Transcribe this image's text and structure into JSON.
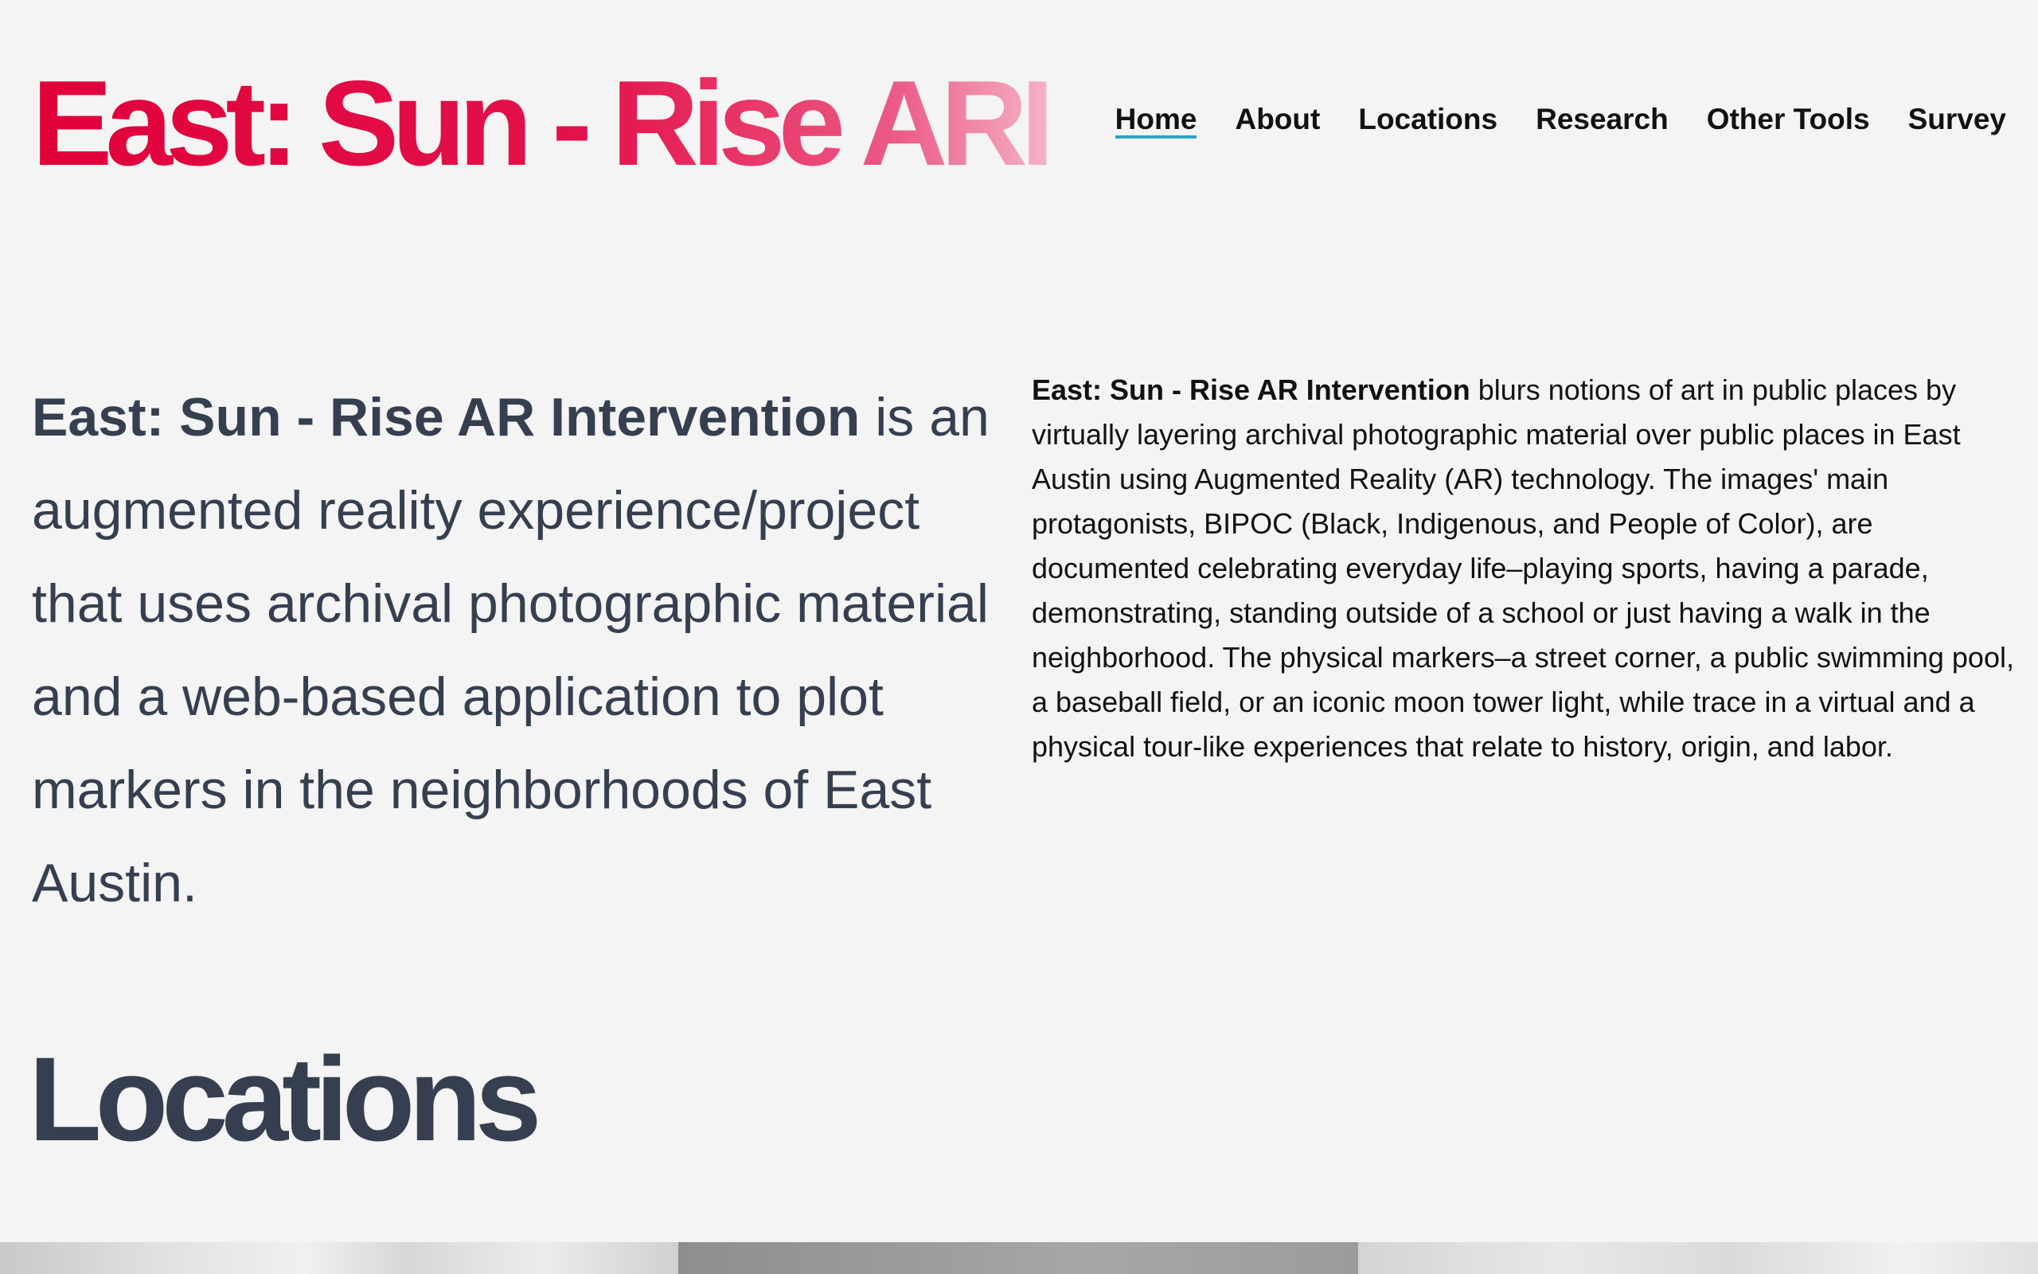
{
  "site": {
    "title": "East: Sun - Rise ARI",
    "brand_color": "#e0003a"
  },
  "nav": {
    "items": [
      {
        "label": "Home",
        "active": true
      },
      {
        "label": "About",
        "active": false
      },
      {
        "label": "Locations",
        "active": false
      },
      {
        "label": "Research",
        "active": false
      },
      {
        "label": "Other Tools",
        "active": false
      },
      {
        "label": "Survey",
        "active": false
      }
    ],
    "active_underline_color": "#2fa3c7"
  },
  "intro": {
    "lead_bold": "East: Sun - Rise AR Intervention",
    "lead_text": " is an augmented reality experience/project that uses archival photographic material and a web-based application to plot markers in the neighborhoods of East Austin.",
    "body_bold": "East: Sun - Rise AR Intervention",
    "body_text": " blurs notions of art in public places by virtually layering archival photographic material over public places in East Austin using Augmented Reality (AR) technology. The images' main protagonists, BIPOC (Black, Indigenous, and People of Color), are documented celebrating everyday life–playing sports, having a parade, demonstrating, standing outside of a school or just having a walk in the neighborhood. The physical markers–a street corner, a public swimming pool, a baseball field, or an iconic moon tower light, while trace in a virtual and a physical tour-like experiences that relate to history, origin, and labor."
  },
  "locations": {
    "heading": "Locations"
  },
  "colors": {
    "background": "#f3f4f3",
    "heading_text": "#353f50",
    "body_text": "#111111"
  }
}
